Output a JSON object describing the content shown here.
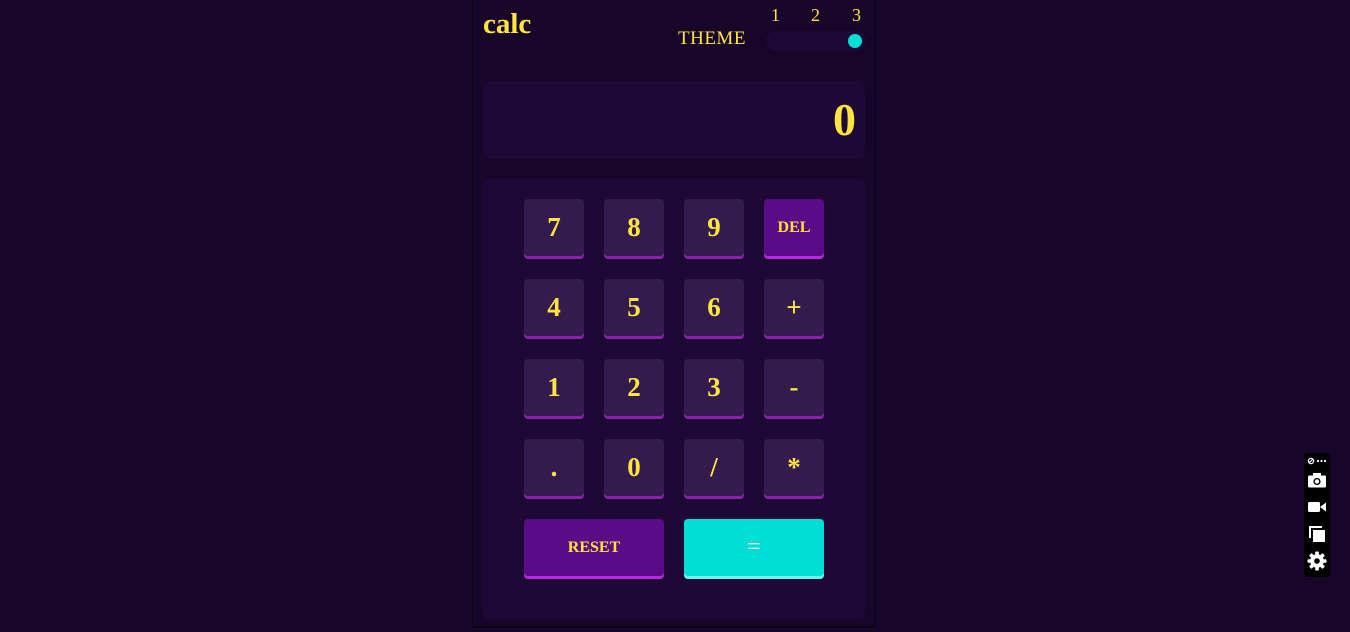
{
  "app": {
    "logo": "calc",
    "theme": {
      "label": "THEME",
      "options": [
        "1",
        "2",
        "3"
      ],
      "selected": "3",
      "knob_color": "#00dfd4"
    },
    "display": {
      "value": "0"
    },
    "keys": {
      "row1": [
        "7",
        "8",
        "9",
        "DEL"
      ],
      "row2": [
        "4",
        "5",
        "6",
        "+"
      ],
      "row3": [
        "1",
        "2",
        "3",
        "-"
      ],
      "row4": [
        ".",
        "0",
        "/",
        "*"
      ],
      "reset": "RESET",
      "equals": "="
    },
    "colors": {
      "background": "#17062a",
      "panel": "#1e0836",
      "key": "#331b4d",
      "key_shadow": "#8b1fab",
      "accent_purple": "#5b0b85",
      "accent_cyan": "#00dfd4",
      "text_yellow": "#ffe53d"
    }
  },
  "toolbar": {
    "icons": [
      "link-more-icon",
      "camera-icon",
      "video-camera-icon",
      "copy-window-icon",
      "gear-icon"
    ]
  }
}
